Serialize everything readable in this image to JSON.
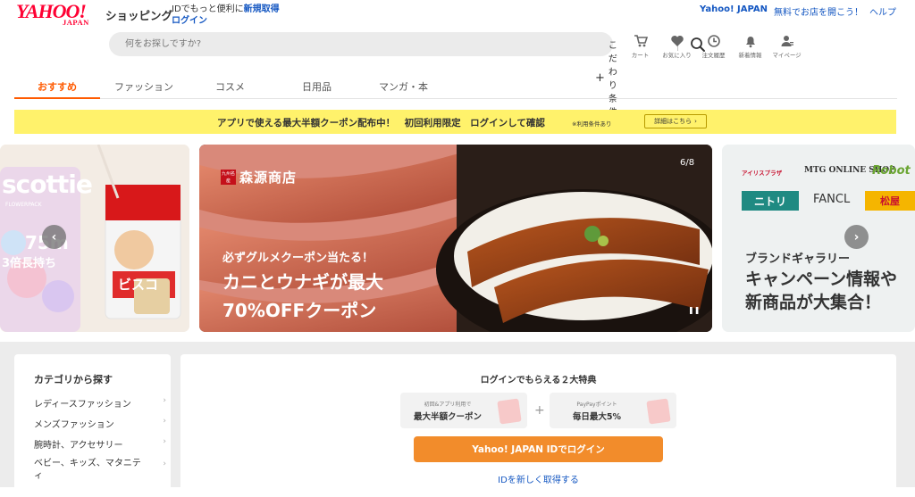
{
  "header": {
    "logo_text": "YAHOO!",
    "logo_sub": "JAPAN",
    "service_name": "ショッピング",
    "id_promo_line1": "IDでもっと便利に",
    "id_promo_register": "新規取得",
    "id_promo_login": "ログイン",
    "top_links": [
      "Yahoo! JAPAN",
      "無料でお店を開こう！",
      "ヘルプ"
    ]
  },
  "search": {
    "placeholder": "何をお探しですか?",
    "conditions_label": "こだわり条件"
  },
  "icon_nav": [
    {
      "label": "カート",
      "icon": "cart-icon"
    },
    {
      "label": "お気に入り",
      "icon": "heart-icon"
    },
    {
      "label": "注文履歴",
      "icon": "history-icon"
    },
    {
      "label": "新着情報",
      "icon": "bell-icon"
    },
    {
      "label": "マイページ",
      "icon": "user-icon"
    }
  ],
  "tabs": [
    {
      "label": "おすすめ",
      "active": true
    },
    {
      "label": "ファッション",
      "active": false
    },
    {
      "label": "コスメ",
      "active": false
    },
    {
      "label": "日用品",
      "active": false
    },
    {
      "label": "マンガ・本",
      "active": false
    }
  ],
  "banner": {
    "text": "アプリで使える最大半額クーポン配布中！　初回利用限定　ログインして確認",
    "note": "※利用条件あり",
    "detail_label": "詳細はこちら"
  },
  "carousel": {
    "counter": "6/8",
    "left_slide": {
      "brand1": "scottie",
      "brand1_sub": "FLOWERPACK",
      "claim": "75m",
      "claim2": "3倍長持ち",
      "brand2": "ビスコ"
    },
    "main_slide": {
      "shop_seal": "九州名産",
      "shop_name": "森源商店",
      "headline": "必ずグルメクーポン当たる！",
      "copy_line1": "カニとウナギが最大",
      "copy_line2": "70%OFFクーポン"
    },
    "right_slide": {
      "logos": [
        "アイリスプラザ",
        "MTG ONLINE SHOP",
        "Robot",
        "ニトリ",
        "FANCL",
        "松屋"
      ],
      "title": "ブランドギャラリー",
      "copy_line1": "キャンペーン情報や",
      "copy_line2": "新商品が大集合！"
    }
  },
  "categories": {
    "title": "カテゴリから探す",
    "items": [
      "レディースファッション",
      "メンズファッション",
      "腕時計、アクセサリー",
      "ベビー、キッズ、マタニティ"
    ]
  },
  "login_panel": {
    "title": "ログインでもらえる２大特典",
    "benefit1_small": "初回&アプリ利用で",
    "benefit1_main": "最大半額クーポン",
    "benefit2_small": "PayPayポイント",
    "benefit2_main": "毎日最大5%",
    "plus": "+",
    "login_button": "Yahoo! JAPAN IDでログイン",
    "register_link": "IDを新しく取得する"
  },
  "colors": {
    "brand_red": "#ff0033",
    "accent_orange": "#ff5a00",
    "login_orange": "#f28c2b",
    "link_blue": "#1457c2",
    "banner_yellow": "#fff26b"
  }
}
